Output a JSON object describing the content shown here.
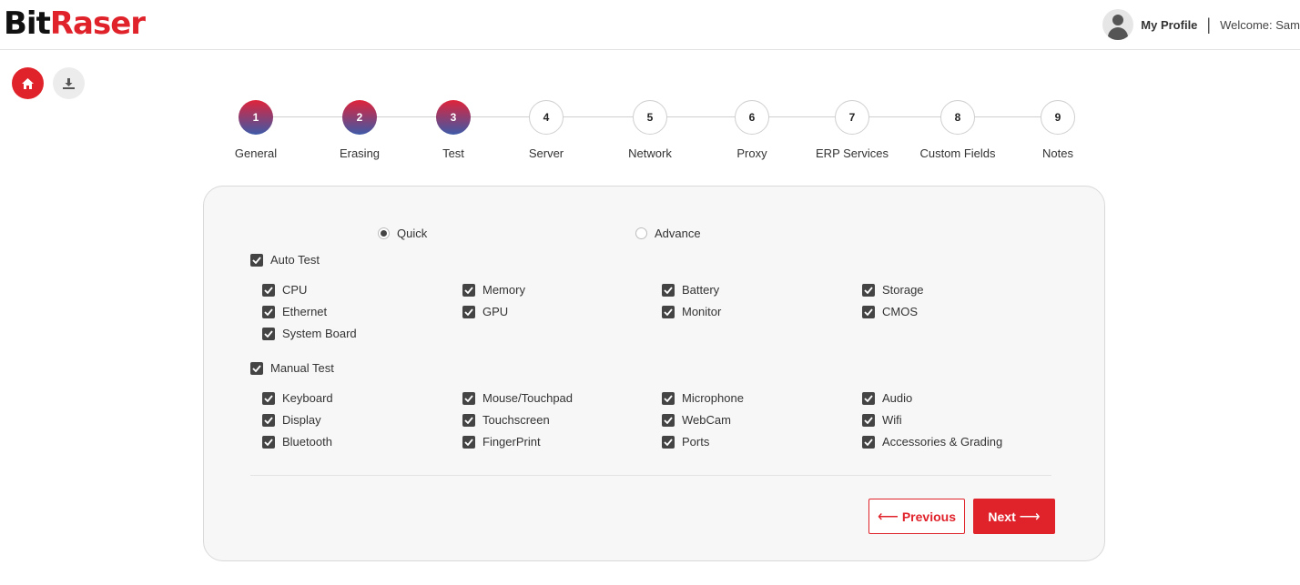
{
  "header": {
    "logo_bit": "Bit",
    "logo_raser": "Raser",
    "profile_label": "My Profile",
    "separator": "|",
    "welcome": "Welcome: Sam"
  },
  "quick_buttons": {
    "home_icon": "home-icon",
    "download_icon": "download-icon"
  },
  "steps": [
    {
      "number": "1",
      "label": "General",
      "state": "done"
    },
    {
      "number": "2",
      "label": "Erasing",
      "state": "done"
    },
    {
      "number": "3",
      "label": "Test",
      "state": "current"
    },
    {
      "number": "4",
      "label": "Server",
      "state": "todo"
    },
    {
      "number": "5",
      "label": "Network",
      "state": "todo"
    },
    {
      "number": "6",
      "label": "Proxy",
      "state": "todo"
    },
    {
      "number": "7",
      "label": "ERP Services",
      "state": "todo"
    },
    {
      "number": "8",
      "label": "Custom Fields",
      "state": "todo"
    },
    {
      "number": "9",
      "label": "Notes",
      "state": "todo"
    }
  ],
  "mode": {
    "quick_label": "Quick",
    "advance_label": "Advance",
    "selected": "Quick"
  },
  "auto_test": {
    "label": "Auto Test",
    "checked": true,
    "items": [
      {
        "label": "CPU",
        "checked": true
      },
      {
        "label": "Memory",
        "checked": true
      },
      {
        "label": "Battery",
        "checked": true
      },
      {
        "label": "Storage",
        "checked": true
      },
      {
        "label": "Ethernet",
        "checked": true
      },
      {
        "label": "GPU",
        "checked": true
      },
      {
        "label": "Monitor",
        "checked": true
      },
      {
        "label": "CMOS",
        "checked": true
      },
      {
        "label": "System Board",
        "checked": true
      }
    ]
  },
  "manual_test": {
    "label": "Manual Test",
    "checked": true,
    "items": [
      {
        "label": "Keyboard",
        "checked": true
      },
      {
        "label": "Mouse/Touchpad",
        "checked": true
      },
      {
        "label": "Microphone",
        "checked": true
      },
      {
        "label": "Audio",
        "checked": true
      },
      {
        "label": "Display",
        "checked": true
      },
      {
        "label": "Touchscreen",
        "checked": true
      },
      {
        "label": "WebCam",
        "checked": true
      },
      {
        "label": "Wifi",
        "checked": true
      },
      {
        "label": "Bluetooth",
        "checked": true
      },
      {
        "label": "FingerPrint",
        "checked": true
      },
      {
        "label": "Ports",
        "checked": true
      },
      {
        "label": "Accessories & Grading",
        "checked": true
      }
    ]
  },
  "buttons": {
    "previous": "Previous",
    "next": "Next"
  },
  "colors": {
    "brand_red": "#e0232b",
    "step_gradient_top": "#e0233a",
    "step_gradient_bottom": "#3d5aa8"
  }
}
